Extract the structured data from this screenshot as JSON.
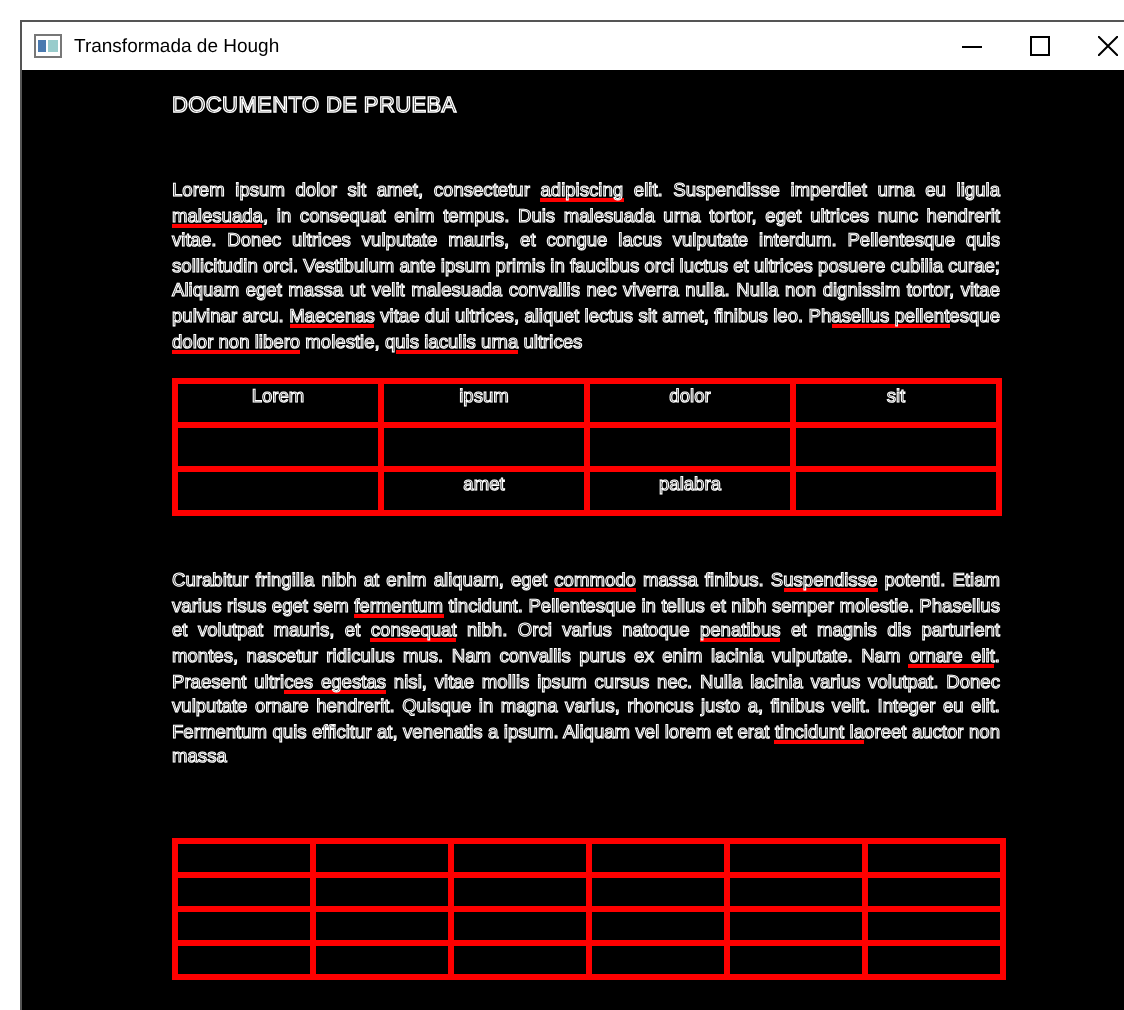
{
  "window": {
    "title": "Transformada de Hough"
  },
  "document": {
    "title": "DOCUMENTO DE PRUEBA",
    "paragraph_1": [
      {
        "text": "Lorem ipsum dolor sit amet, consectetur ",
        "hough_line": false
      },
      {
        "text": "adipiscing",
        "hough_line": true
      },
      {
        "text": " elit. Suspendisse imperdiet urna eu ligula ",
        "hough_line": false
      },
      {
        "text": "malesuada",
        "hough_line": true
      },
      {
        "text": ", in consequat enim tempus. Duis malesuada urna tortor, eget ultrices nunc hendrerit vitae. Donec ultrices vulputate mauris, et congue lacus vulputate interdum. Pellentesque quis sollicitudin orci. Vestibulum ante ipsum primis in faucibus orci luctus et ultrices posuere cubilia curae; Aliquam eget massa ut velit malesuada convallis nec viverra nulla. Nulla non dignissim tortor, vitae pulvinar arcu. ",
        "hough_line": false
      },
      {
        "text": "Maecenas",
        "hough_line": true
      },
      {
        "text": " vitae dui ultrices, aliquet lectus sit amet, finibus leo. Ph",
        "hough_line": false
      },
      {
        "text": "asellus pellent",
        "hough_line": true
      },
      {
        "text": "esque ",
        "hough_line": false
      },
      {
        "text": "dolor non libero",
        "hough_line": true
      },
      {
        "text": " molestie, q",
        "hough_line": false
      },
      {
        "text": "uis iaculis urna",
        "hough_line": true
      },
      {
        "text": " ultrices",
        "hough_line": false
      }
    ],
    "table_1": {
      "rows": [
        {
          "cells": [
            {
              "text": "Lorem"
            },
            {
              "text": "ipsum"
            },
            {
              "text": "dolor"
            },
            {
              "text": "sit"
            }
          ]
        },
        {
          "cells": [
            {},
            {},
            {},
            {}
          ]
        },
        {
          "cells": [
            {},
            {
              "text": "amet"
            },
            {
              "text": "palabra"
            },
            {}
          ]
        }
      ]
    },
    "paragraph_2": [
      {
        "text": "Curabitur fringilla nibh at enim aliquam, eget ",
        "hough_line": false
      },
      {
        "text": "commodo",
        "hough_line": true
      },
      {
        "text": " massa finibus. S",
        "hough_line": false
      },
      {
        "text": "uspendisse",
        "hough_line": true
      },
      {
        "text": " potenti. Etiam varius risus eget sem ",
        "hough_line": false
      },
      {
        "text": "fermentum",
        "hough_line": true
      },
      {
        "text": " tincidunt. Pellentesque in tellus et nibh semper molestie. Phasellus et volutpat mauris, et ",
        "hough_line": false
      },
      {
        "text": "consequat",
        "hough_line": true
      },
      {
        "text": " nibh. Orci varius natoque ",
        "hough_line": false
      },
      {
        "text": "penatibus",
        "hough_line": true
      },
      {
        "text": " et magnis dis parturient montes, nascetur ridiculus mus. Nam convallis purus ex enim lacinia vulputate. Nam ",
        "hough_line": false
      },
      {
        "text": "ornare elit",
        "hough_line": true
      },
      {
        "text": ". Praesent ultri",
        "hough_line": false
      },
      {
        "text": "ces egestas",
        "hough_line": true
      },
      {
        "text": " nisi, vitae mollis ipsum cursus nec. Nulla lacinia varius volutpat. Donec vulputate ornare hendrerit. Quisque in magna varius, rhoncus justo a, finibus velit. Integer eu elit. Fermentum quis efficitur at, venenatis a ipsum. Aliquam vel lorem et erat ",
        "hough_line": false
      },
      {
        "text": "tincidunt la",
        "hough_line": true
      },
      {
        "text": "oreet auctor non massa",
        "hough_line": false
      }
    ],
    "table_2": {
      "rows": [
        {
          "cells": [
            {},
            {},
            {},
            {},
            {},
            {}
          ]
        },
        {
          "cells": [
            {},
            {},
            {},
            {},
            {},
            {}
          ]
        },
        {
          "cells": [
            {},
            {},
            {},
            {},
            {},
            {}
          ]
        },
        {
          "cells": [
            {},
            {},
            {},
            {},
            {},
            {}
          ]
        }
      ]
    }
  }
}
